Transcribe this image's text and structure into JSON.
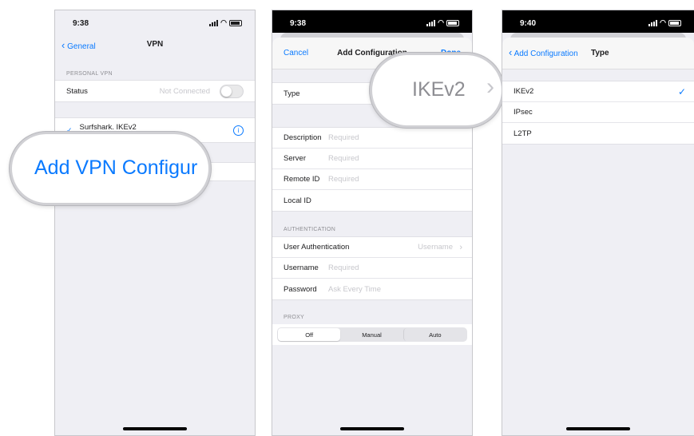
{
  "screen1": {
    "time": "9:38",
    "nav": {
      "back_label": "General",
      "title": "VPN"
    },
    "section_personal_vpn": "PERSONAL VPN",
    "status_label": "Status",
    "status_value": "Not Connected",
    "vpn_name": "Surfshark. IKEv2",
    "magnifier_text": "Add VPN Configur"
  },
  "screen2": {
    "time": "9:38",
    "nav": {
      "cancel_label": "Cancel",
      "title": "Add Configuration",
      "done_label": "Done"
    },
    "type_label": "Type",
    "magnifier_value": "IKEv2",
    "fields": [
      {
        "label": "Description",
        "placeholder": "Required"
      },
      {
        "label": "Server",
        "placeholder": "Required"
      },
      {
        "label": "Remote ID",
        "placeholder": "Required"
      },
      {
        "label": "Local ID",
        "placeholder": ""
      }
    ],
    "section_authentication": "AUTHENTICATION",
    "user_auth_label": "User Authentication",
    "user_auth_value": "Username",
    "username_label": "Username",
    "username_placeholder": "Required",
    "password_label": "Password",
    "password_placeholder": "Ask Every Time",
    "section_proxy": "PROXY",
    "proxy_options": [
      "Off",
      "Manual",
      "Auto"
    ],
    "proxy_selected": "Off"
  },
  "screen3": {
    "time": "9:40",
    "nav": {
      "back_label": "Add Configuration",
      "title": "Type"
    },
    "options": [
      "IKEv2",
      "IPsec",
      "L2TP"
    ],
    "selected": "IKEv2"
  },
  "colors": {
    "accent": "#0a7aff",
    "background": "#efeff4",
    "placeholder": "#c7c7cc"
  }
}
